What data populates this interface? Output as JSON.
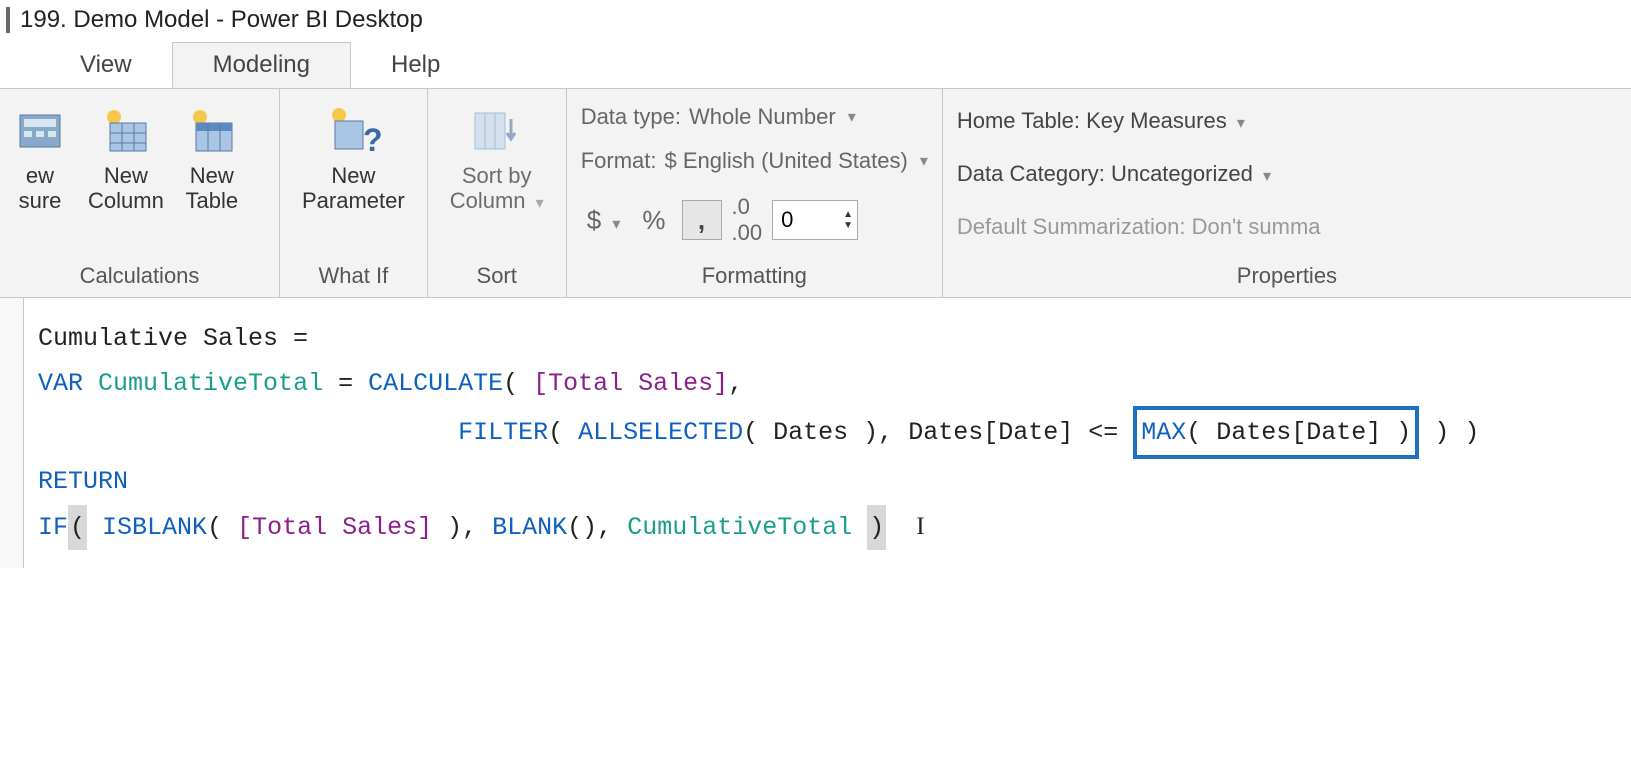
{
  "title": "199. Demo Model - Power BI Desktop",
  "tabs": {
    "view": "View",
    "modeling": "Modeling",
    "help": "Help"
  },
  "ribbon": {
    "calculations": {
      "label": "Calculations",
      "new_measure": "ew\nsure",
      "new_column": "New\nColumn",
      "new_table": "New\nTable"
    },
    "whatif": {
      "label": "What If",
      "new_parameter": "New\nParameter"
    },
    "sort": {
      "label": "Sort",
      "sort_by_column": "Sort by\nColumn"
    },
    "formatting": {
      "label": "Formatting",
      "data_type_label": "Data type:",
      "data_type_value": "Whole Number",
      "format_label": "Format:",
      "format_value": "$ English (United States)",
      "currency": "$",
      "percent": "%",
      "decimal_places": "0"
    },
    "properties": {
      "label": "Properties",
      "home_table_label": "Home Table:",
      "home_table_value": "Key Measures",
      "data_category_label": "Data Category:",
      "data_category_value": "Uncategorized",
      "default_sum": "Default Summarization: Don't summa"
    }
  },
  "formula": {
    "line1_measure": "Cumulative Sales",
    "eq": " = ",
    "var": "VAR",
    "cumvar": "CumulativeTotal",
    "calc": "CALCULATE",
    "total_sales": "[Total Sales]",
    "filter": "FILTER",
    "allsel": "ALLSELECTED",
    "dates": "Dates",
    "datescol": "Dates[Date]",
    "max": "MAX",
    "return": "RETURN",
    "if": "IF",
    "isblank": "ISBLANK",
    "blank": "BLANK"
  }
}
